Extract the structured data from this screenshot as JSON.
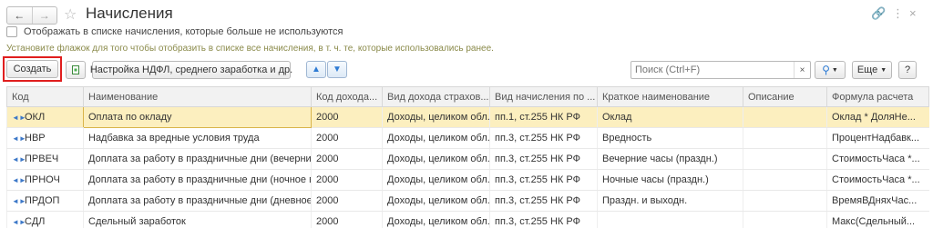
{
  "window": {
    "title": "Начисления",
    "link_icon": "link-icon",
    "more_icon": "more-vertical-icon",
    "close_icon": "close-icon"
  },
  "nav": {
    "back_icon": "arrow-left-icon",
    "forward_icon": "arrow-right-icon",
    "favorite_icon": "star-icon"
  },
  "filter": {
    "show_unused_label": "Отображать в списке начисления, которые больше не используются",
    "hint": "Установите флажок для того чтобы отобразить в списке все начисления, в т. ч. те, которые использовались ранее."
  },
  "toolbar": {
    "create_label": "Создать",
    "ndfl_label": "Настройка НДФЛ, среднего заработка и др.",
    "search_placeholder": "Поиск (Ctrl+F)",
    "clear_glyph": "×",
    "more_label": "Еще",
    "help_label": "?"
  },
  "table": {
    "columns": [
      "Код",
      "Наименование",
      "Код дохода...",
      "Вид дохода страхов...",
      "Вид начисления по ...",
      "Краткое наименование",
      "Описание",
      "Формула расчета"
    ],
    "rows": [
      {
        "code": "ОКЛ",
        "name": "Оплата по окладу",
        "income_code": "2000",
        "ins_type": "Доходы, целиком обл...",
        "accr_type": "пп.1, ст.255 НК РФ",
        "short": "Оклад",
        "descr": "",
        "formula": "Оклад * ДоляНе..."
      },
      {
        "code": "НВР",
        "name": "Надбавка за вредные условия труда",
        "income_code": "2000",
        "ins_type": "Доходы, целиком обл...",
        "accr_type": "пп.3, ст.255 НК РФ",
        "short": "Вредность",
        "descr": "",
        "formula": "ПроцентНадбавк..."
      },
      {
        "code": "ПРВЕЧ",
        "name": "Доплата за работу в праздничные дни (вечерние ...",
        "income_code": "2000",
        "ins_type": "Доходы, целиком обл...",
        "accr_type": "пп.3, ст.255 НК РФ",
        "short": "Вечерние часы (праздн.)",
        "descr": "",
        "formula": "СтоимостьЧаса *..."
      },
      {
        "code": "ПРНОЧ",
        "name": "Доплата за работу в праздничные дни (ночное вр...",
        "income_code": "2000",
        "ins_type": "Доходы, целиком обл...",
        "accr_type": "пп.3, ст.255 НК РФ",
        "short": "Ночные часы (праздн.)",
        "descr": "",
        "formula": "СтоимостьЧаса *..."
      },
      {
        "code": "ПРДОП",
        "name": "Доплата за работу в праздничные дни (дневное ...",
        "income_code": "2000",
        "ins_type": "Доходы, целиком обл...",
        "accr_type": "пп.3, ст.255 НК РФ",
        "short": "Праздн. и выходн.",
        "descr": "",
        "formula": "ВремяВДняхЧас..."
      },
      {
        "code": "СДЛ",
        "name": "Сдельный заработок",
        "income_code": "2000",
        "ins_type": "Доходы, целиком обл...",
        "accr_type": "пп.3, ст.255 НК РФ",
        "short": "",
        "descr": "",
        "formula": "Макс(Сдельный..."
      }
    ]
  }
}
